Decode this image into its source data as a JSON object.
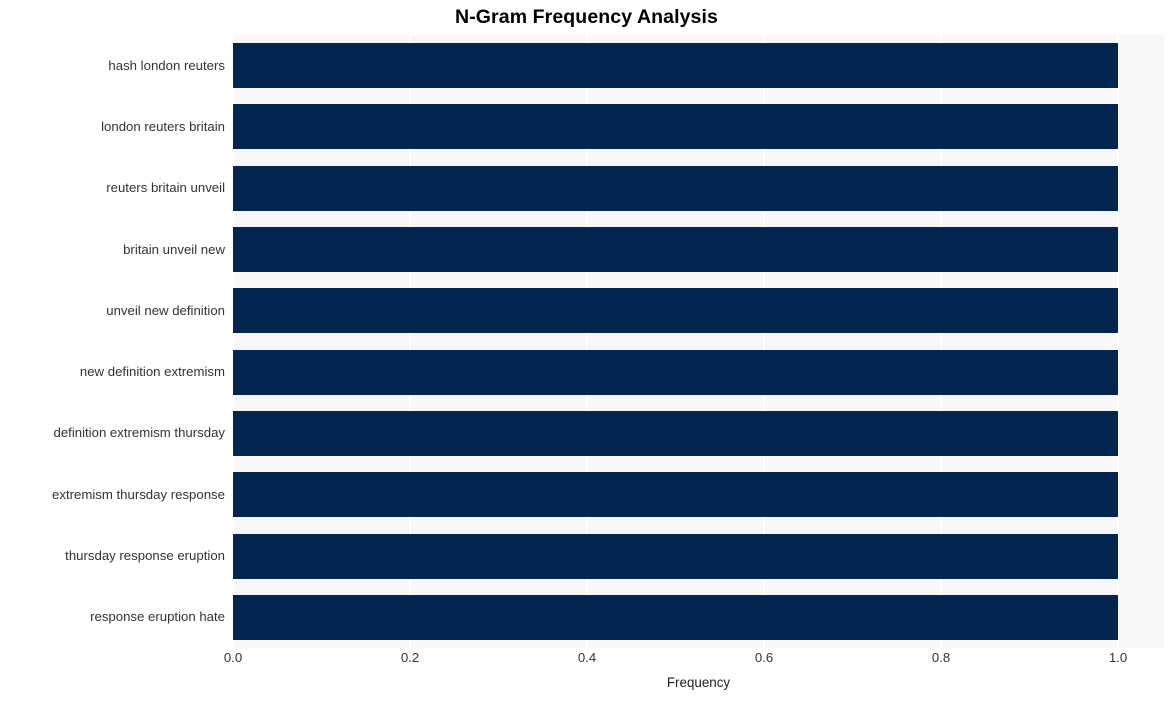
{
  "chart_data": {
    "type": "bar",
    "orientation": "horizontal",
    "title": "N-Gram Frequency Analysis",
    "xlabel": "Frequency",
    "ylabel": "",
    "categories": [
      "hash london reuters",
      "london reuters britain",
      "reuters britain unveil",
      "britain unveil new",
      "unveil new definition",
      "new definition extremism",
      "definition extremism thursday",
      "extremism thursday response",
      "thursday response eruption",
      "response eruption hate"
    ],
    "values": [
      1.0,
      1.0,
      1.0,
      1.0,
      1.0,
      1.0,
      1.0,
      1.0,
      1.0,
      1.0
    ],
    "xlim": [
      0.0,
      1.0
    ],
    "xticks": [
      0.0,
      0.2,
      0.4,
      0.6,
      0.8,
      1.0
    ],
    "xtick_labels": [
      "0.0",
      "0.2",
      "0.4",
      "0.6",
      "0.8",
      "1.0"
    ],
    "grid": true,
    "grid_axis": "x",
    "legend": false,
    "bar_color": "#02264f",
    "plot_background": "#f7f7f7",
    "figure_background": "#ffffff",
    "gridline_color": "#ffffff",
    "tick_label_color": "#333333"
  }
}
